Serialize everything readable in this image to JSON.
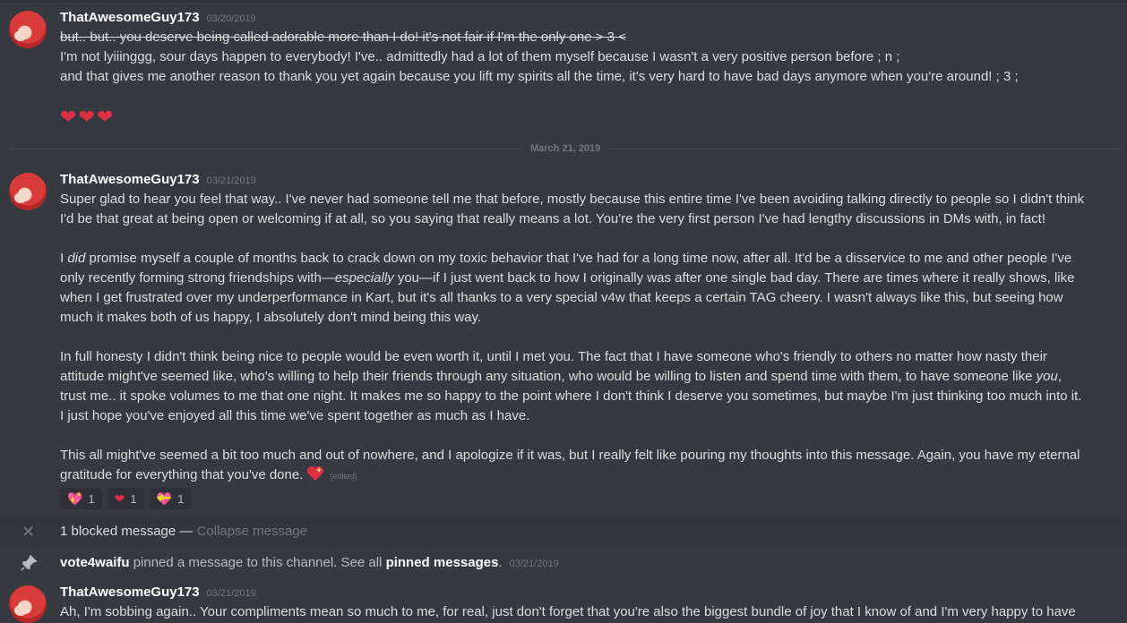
{
  "messages": [
    {
      "username": "ThatAwesomeGuy173",
      "timestamp": "03/20/2019",
      "lines": [
        "but.. but.. you deserve being called adorable more than I do! it's not fair if I'm the only one > 3 <",
        "I'm not lyiiinggg, sour days happen to everybody! I've.. admittedly had a lot of them myself because I wasn't a very positive person before ; n ;",
        "and that gives me another reason to thank you yet again because you lift my spirits all the time, it's very hard to have bad days anymore when you're around! ; 3 ;"
      ],
      "emoji": [
        "heart",
        "heart",
        "heart"
      ]
    },
    {
      "username": "ThatAwesomeGuy173",
      "timestamp": "03/21/2019",
      "lines": [
        "Super glad to hear you feel that way.. I've never had someone tell me that before, mostly because this entire time I've been avoiding talking directly to people so I didn't think",
        "I'd be that great at being open or welcoming if at all, so you saying that really means a lot. You're the very first person I've had lengthy discussions in DMs with, in fact!",
        "",
        "I did promise myself a couple of months back to crack down on my toxic behavior that I've had for a long time now, after all. It'd be a disservice to me and other people I've",
        "only recently forming strong friendships with—especially you—if I just went back to how I originally was after one single bad day. There are times where it really shows, like",
        "when I get frustrated over my underperformance in Kart, but it's all thanks to a very special v4w that keeps a certain TAG cheery. I wasn't always like this, but seeing how",
        "much it makes both of us happy, I absolutely don't mind being this way.",
        "",
        "In full honesty I didn't think being nice to people would be even worth it, until I met you. The fact that I have someone who's friendly to others no matter how nasty their",
        "attitude might've seemed like, who's willing to help their friends through any situation, who would be willing to listen and spend time with them, to have someone like you,",
        "trust me.. it spoke volumes to me that one night. It makes me so happy to the point where I don't think I deserve you sometimes, but maybe I'm just thinking too much into it.",
        "I just hope you've enjoyed all this time we've spent together as much as I have.",
        "",
        "This all might've seemed a bit too much and out of nowhere, and I apologize if it was, but I really felt like pouring my thoughts into this message. Again, you have my eternal",
        "gratitude for everything that you've done."
      ],
      "edited_label": "(edited)",
      "reactions": [
        {
          "emoji": "sparkling-heart",
          "count": "1"
        },
        {
          "emoji": "heart",
          "count": "1"
        },
        {
          "emoji": "heart-with-ribbon",
          "count": "1"
        }
      ]
    },
    {
      "username": "ThatAwesomeGuy173",
      "timestamp": "03/21/2019",
      "lines": [
        "Ah, I'm sobbing again.. Your compliments mean so much to me, for real, just don't forget that you're also the biggest bundle of joy that I know of and I'm very happy to have"
      ]
    }
  ],
  "date_divider": "March 21, 2019",
  "blocked": {
    "text": "1 blocked message — ",
    "action": "Collapse message"
  },
  "pin_notice": {
    "user": "vote4waifu",
    "text": " pinned a message to this channel. See all ",
    "link": "pinned messages",
    "after": ".",
    "timestamp": "03/21/2019"
  },
  "colors": {
    "background": "#36393f",
    "text": "#dcddde",
    "muted": "#72767d",
    "heart": "#dd2e44"
  }
}
